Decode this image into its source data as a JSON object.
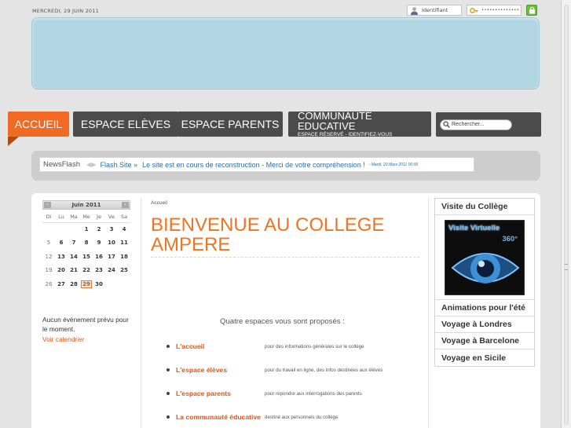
{
  "header": {
    "date": "MERCREDI, 29 JUIN 2011",
    "login_placeholder": "Identifiant",
    "password_mask": "••••••••••••••",
    "accent_color": "#f06a24",
    "nav_color": "#4b4b4b",
    "banner_color": "#b2d6e4"
  },
  "nav": {
    "tabs": [
      {
        "label": "ACCUEIL",
        "active": true
      },
      {
        "label": "ESPACE ELÈVES"
      },
      {
        "label": "ESPACE PARENTS"
      },
      {
        "label": "COMMUNAUTÉ EDUCATIVE",
        "sub": "ESPACE RÉSERVÉ - IDENTIFIEZ-VOUS"
      }
    ],
    "search_placeholder": "Rechercher..."
  },
  "newsflash": {
    "label": "NewsFlash",
    "arrows": "◀ ▶",
    "site": "Flash Site »",
    "message": "Le site est en cours de reconstruction - Merci de votre compréhension !",
    "date": "- Mardi, 29 Mars 2011 00:00"
  },
  "calendar": {
    "month": "Juin 2011",
    "prev": "‹",
    "next": "›",
    "weekdays": [
      "Di",
      "Lu",
      "Ma",
      "Me",
      "Je",
      "Ve",
      "Sa"
    ],
    "weeks": [
      [
        "",
        "",
        "",
        "1",
        "2",
        "3",
        "4"
      ],
      [
        "5",
        "6",
        "7",
        "8",
        "9",
        "10",
        "11"
      ],
      [
        "12",
        "13",
        "14",
        "15",
        "16",
        "17",
        "18"
      ],
      [
        "19",
        "20",
        "21",
        "22",
        "23",
        "24",
        "25"
      ],
      [
        "26",
        "27",
        "28",
        "29",
        "30",
        "",
        ""
      ]
    ],
    "today": "29",
    "no_event": "Aucun évènement prévu pour le moment.",
    "link": "Voir calendrier"
  },
  "main": {
    "breadcrumb": "Accueil",
    "title_line1": "BIENVENUE AU COLLEGE",
    "title_line2": "AMPERE",
    "intro": "Quatre espaces vous sont proposés :",
    "spaces": [
      {
        "name": "L'accueil",
        "desc": "pour des informations générales sur le collège"
      },
      {
        "name": "L'espace élèves",
        "desc": "pour du travail en ligne, des infos destinées aux élèves"
      },
      {
        "name": "L'espace parents",
        "desc": "pour répondre aux interrogations des parents"
      },
      {
        "name": "La communauté éducative",
        "desc": "destiné aux personnels du collège"
      }
    ]
  },
  "sidebar": {
    "top": "Visite du Collège",
    "image_text1": "Visite Virtuelle",
    "image_text2": "360°",
    "items": [
      "Animations pour l'été",
      "Voyage à Londres",
      "Voyage à Barcelone",
      "Voyage en Sicile"
    ]
  }
}
